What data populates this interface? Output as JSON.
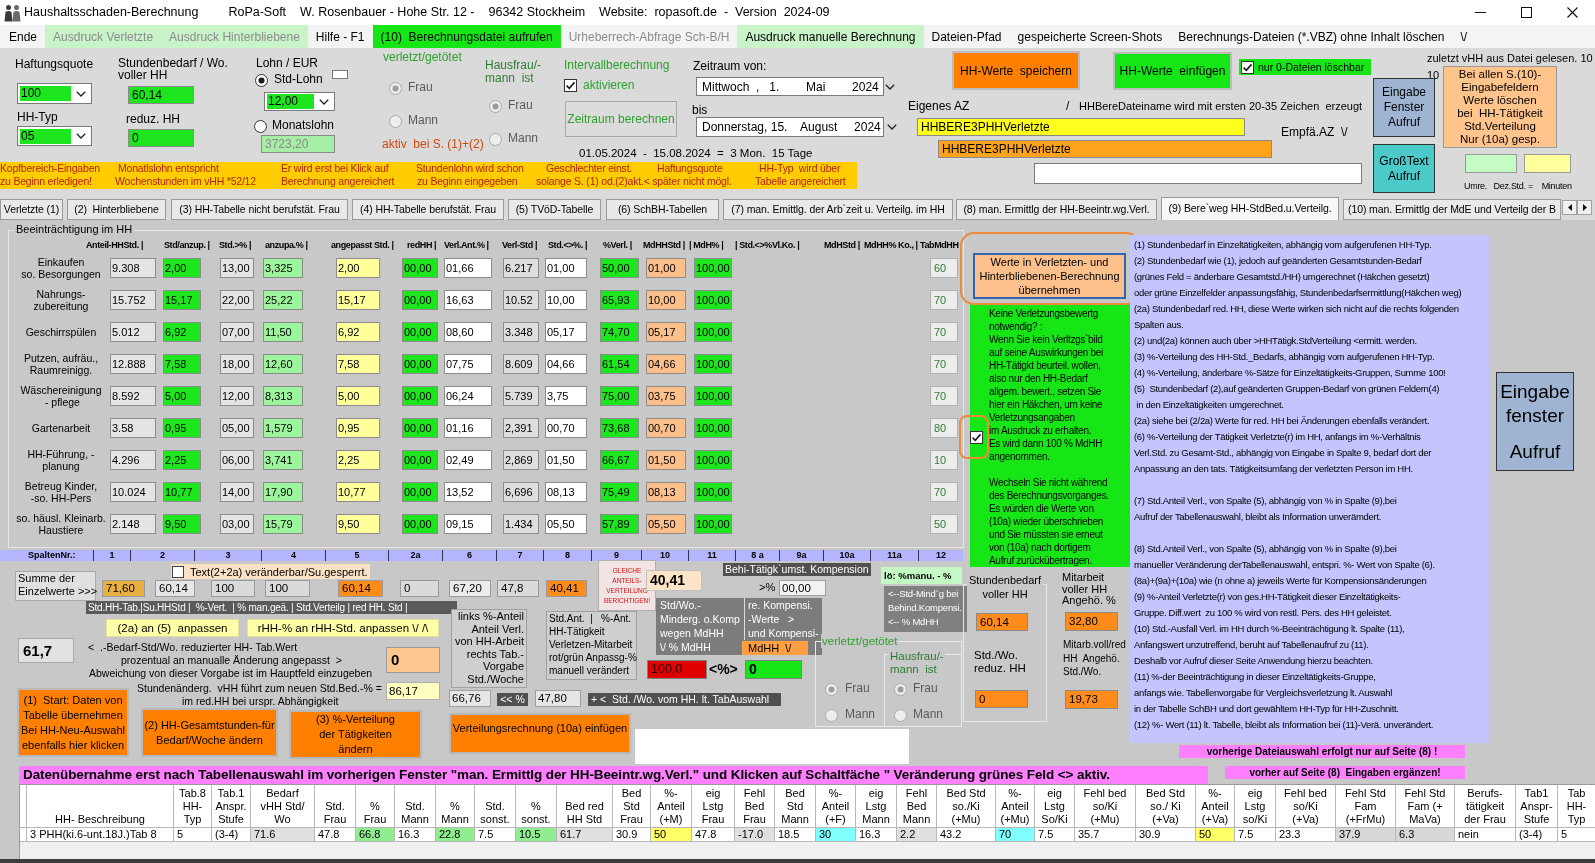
{
  "window": {
    "title": "Haushaltsschaden-Berechnung",
    "info": [
      "RoPa-Soft",
      "W. Rosenbauer - Hohe Str. 12 -",
      "96342 Stockheim",
      "Website:  ropasoft.de  -  Version  2024-09"
    ]
  },
  "menu": [
    {
      "label": "Ende",
      "kind": "plain",
      "disabled": false
    },
    {
      "label": "Ausdruck Verletzte",
      "kind": "pale",
      "disabled": true
    },
    {
      "label": "Ausdruck Hinterbliebene",
      "kind": "pale",
      "disabled": true
    },
    {
      "label": "Hilfe - F1",
      "kind": "plain",
      "disabled": false
    },
    {
      "label": "(10)  Berechnungsdatei aufrufen",
      "kind": "strong",
      "disabled": false
    },
    {
      "label": "Urheberrech-Abfrage Sch-B/H",
      "kind": "plain",
      "disabled": true
    },
    {
      "label": "Ausdruck manuelle Berechnung",
      "kind": "pale",
      "disabled": false
    },
    {
      "label": "Dateien-Pfad",
      "kind": "plain",
      "disabled": false
    },
    {
      "label": "gespeicherte Screen-Shots",
      "kind": "plain",
      "disabled": false
    },
    {
      "label": "Berechnungs-Dateien (*.VBZ) ohne Inhalt löschen",
      "kind": "plain",
      "disabled": false
    },
    {
      "label": "\\/",
      "kind": "plain",
      "disabled": false
    }
  ],
  "header_form": {
    "liability": {
      "label": "Haftungsquote",
      "value": "100"
    },
    "household_type": {
      "label": "HH-Typ",
      "value": "05"
    },
    "hours_full": {
      "label_lines": [
        "Stundenbedarf / Wo.",
        "voller HH"
      ],
      "value": "60,14"
    },
    "hours_reduced": {
      "label": "reduz. HH",
      "value": "0"
    },
    "wage": {
      "label": "Lohn / EUR",
      "options": [
        {
          "label": "Std-Lohn",
          "selected": true
        },
        {
          "label": "Monatslohn",
          "selected": false
        }
      ],
      "hourly": "12,00",
      "monthly": "3723,20"
    },
    "injured": {
      "label": "verletzt/getötet",
      "disabled": true,
      "options": [
        {
          "label": "Frau",
          "selected": true
        },
        {
          "label": "Mann",
          "selected": false
        }
      ],
      "note": "aktiv  bei S. (1)+(2)"
    },
    "homemaker": {
      "label_lines": [
        "Hausfrau/-",
        "mann  ist"
      ],
      "disabled": true,
      "options": [
        {
          "label": "Frau",
          "selected": true
        },
        {
          "label": "Mann",
          "selected": false
        }
      ]
    },
    "interval": {
      "label": "Intervallberechnung",
      "checkbox_label": "aktivieren",
      "checked": true,
      "button": "Zeitraum berechnen"
    },
    "period": {
      "from_label": "Zeitraum von:",
      "from": "Mittwoch  ,   1.        Mai        2024",
      "to_label": "bis",
      "to": "Donnerstag, 15.    August     2024",
      "summary": "01.05.2024  -  15.08.2024  =  3 Mon.  15 Tage"
    }
  },
  "file_panel": {
    "save_button": "HH-Werte  speichern",
    "insert_button": "HH-Werte  einfügen",
    "zero_files": {
      "label": "nur 0-Dateien löschbar",
      "checked": true
    },
    "last_read": "zuletzt vHH aus Datei gelesen. 10",
    "last_read_value": "10",
    "clear_button_lines": [
      "Bei allen S.(10)-",
      "Eingabefeldern",
      "Werte löschen",
      "bei  HH-Tätigkeit",
      "Std.Verteilung",
      "Nur (10a) gesp."
    ],
    "input_window_button_lines": [
      "Eingabe",
      "Fenster",
      "Aufruf"
    ],
    "large_text_button_lines": [
      "GroßText",
      "Aufruf"
    ],
    "converter_label": "Umre.   Dez.Std. =    Minuten",
    "own_ref_label": "Eigenes AZ",
    "separator": "/",
    "file_name_hint": "HHBereDateiname wird mit ersten 20-35 Zeichen  erzeugt",
    "own_ref": "HHBERE3PHHVerletzte",
    "recipient_label": "Empfä.AZ  \\/",
    "recipient_ref": "HHBERE3PHHVerletzte"
  },
  "hint_banner": {
    "notes": [
      {
        "lines": [
          "Kopfbereich-Eingaben",
          "zu Beginn erledigen!"
        ]
      },
      {
        "lines": [
          "Monatlslohn entspricht",
          "Wochenstunden im vHH *52/12"
        ]
      },
      {
        "lines": [
          "Er wird erst bei Klick auf",
          "Berechnung angereichert"
        ]
      },
      {
        "lines": [
          "Stundenlohn wird schon",
          "zu Beginn eingegeben"
        ]
      },
      {
        "lines": [
          "Geschlechter einst.",
          "solange S. (1) od.(2)akt.< später nicht mögl."
        ]
      },
      {
        "lines": [
          "Haftungsquote"
        ]
      },
      {
        "lines": [
          "HH-Typ  wird über",
          "Tabelle angereichert"
        ]
      }
    ]
  },
  "tabs": [
    {
      "label": "Verletzte (1)",
      "selected": false
    },
    {
      "label": "(2)  Hinterbliebene",
      "selected": false
    },
    {
      "label": "(3) HH-Tabelle nicht berufstät. Frau",
      "selected": false
    },
    {
      "label": "(4) HH-Tabelle berufstät. Frau",
      "selected": false
    },
    {
      "label": "(5) TVöD-Tabelle",
      "selected": false
    },
    {
      "label": "(6) SchBH-Tabellen",
      "selected": false
    },
    {
      "label": "(7) man. Emittlg. der Arb`zeit u. Verteilg. im HH",
      "selected": false
    },
    {
      "label": "(8) man. Ermittlg der HH-Beeintr.wg.Verl.",
      "selected": false
    },
    {
      "label": "(9) Bere`weg HH-StdBed.u.Verteilg.",
      "selected": true
    },
    {
      "label": "(10) man. Ermittlg der MdE und Verteilg der B",
      "selected": false
    }
  ],
  "impairment": {
    "title": "Beeinträchtigung im HH",
    "header": [
      "Anteil-HHStd. |",
      "Std/anzup. |",
      "Std.>% |",
      "anzupa.% |",
      "angepasst Std. |",
      "redHH |",
      "Verl.Ant.% |",
      "Verl-Std |",
      "Std.<>%. |",
      "%Verl. |",
      "MdHHStd |",
      "| MdH% |",
      "| Std.<>%Vl.Ko. |",
      "MdHStd |",
      "MdHH% Ko., |",
      "TabMdHH"
    ],
    "rows": [
      {
        "label_lines": [
          "Einkaufen",
          "so. Besorgungen"
        ],
        "values": [
          "9.308",
          "2,00",
          "13,00",
          "3,325",
          "2,00",
          "00,00",
          "01,66",
          "6.217",
          "01,00",
          "50,00",
          "01,00",
          "100,00"
        ],
        "table_value": "60"
      },
      {
        "label_lines": [
          "Nahrungs-",
          "zubereitung"
        ],
        "values": [
          "15.752",
          "15,17",
          "22,00",
          "25,22",
          "15,17",
          "00,00",
          "16,63",
          "10.52",
          "10,00",
          "65,93",
          "10,00",
          "100,00"
        ],
        "table_value": "70"
      },
      {
        "label_lines": [
          "Geschirrspülen"
        ],
        "values": [
          "5.012",
          "6,92",
          "07,00",
          "11,50",
          "6,92",
          "00,00",
          "08,60",
          "3.348",
          "05,17",
          "74,70",
          "05,17",
          "100,00"
        ],
        "table_value": "70"
      },
      {
        "label_lines": [
          "Putzen, aufräu.,",
          "Raumreinigg."
        ],
        "values": [
          "12.888",
          "7,58",
          "18,00",
          "12,60",
          "7,58",
          "00,00",
          "07,75",
          "8.609",
          "04,66",
          "61,54",
          "04,66",
          "100,00"
        ],
        "table_value": "70"
      },
      {
        "label_lines": [
          "Wäschereinigung",
          " - pflege"
        ],
        "values": [
          "8.592",
          "5,00",
          "12,00",
          "8,313",
          "5,00",
          "00,00",
          "06,24",
          "5.739",
          "3,75",
          "75,00",
          "03,75",
          "100,00"
        ],
        "table_value": "70"
      },
      {
        "label_lines": [
          "Gartenarbeit"
        ],
        "values": [
          "3.58",
          "0,95",
          "05,00",
          "1,579",
          "0,95",
          "00,00",
          "01,16",
          "2,391",
          "00,70",
          "73,68",
          "00,70",
          "100,00"
        ],
        "table_value": "80"
      },
      {
        "label_lines": [
          "HH-Führung, -",
          "planung"
        ],
        "values": [
          "4.296",
          "2,25",
          "06,00",
          "3,741",
          "2,25",
          "00,00",
          "02,49",
          "2,869",
          "01,50",
          "66,67",
          "01,50",
          "100,00"
        ],
        "table_value": "10"
      },
      {
        "label_lines": [
          "Betreug Kinder,",
          "-so. HH-Pers"
        ],
        "values": [
          "10.024",
          "10,77",
          "14,00",
          "17,90",
          "10,77",
          "00,00",
          "13,52",
          "6,696",
          "08,13",
          "75,49",
          "08,13",
          "100,00"
        ],
        "table_value": "70"
      },
      {
        "label_lines": [
          "so. häusl. Kleinarb.",
          "Haustiere"
        ],
        "values": [
          "2.148",
          "9,50",
          "03,00",
          "15,79",
          "9,50",
          "00,00",
          "09,15",
          "1.434",
          "05,50",
          "57,89",
          "05,50",
          "100,00"
        ],
        "table_value": "50"
      }
    ],
    "column_numbers_label": "SpaltenNr.:",
    "column_numbers": [
      "1",
      "2",
      "3",
      "4",
      "5",
      "2a",
      "6",
      "7",
      "8",
      "9",
      "10",
      "11",
      "8 a",
      "9a",
      "10a",
      "11a",
      "12"
    ]
  },
  "transfer_button": {
    "lines": [
      "Werte in Verletzten- und",
      "Hinterbliebenen-Berechnung",
      "übernehmen"
    ]
  },
  "no_injury": {
    "checked": true,
    "lines": [
      "Keine Verletzungsbewertg",
      "notwendig? :",
      "Wenn Sie kein Verltzgs`bild",
      "auf seine Auswirkungen bei",
      "HH-Tätigkt beurteil. wollen,",
      "also nur den HH-Bedarf",
      "allgem. bewert., setzen Sie",
      "hier ein Häkchen, um keine",
      "Verletzungsangaben",
      "im Ausdruck zu erhalten.",
      "Es wird dann 100 % MdHH",
      "angenommen."
    ],
    "warning_lines": [
      "Wechseln Sie nicht während",
      "des Berechnungsvorganges.",
      "Es würden die Werte von",
      "(10a) wieder überschrieben",
      "und Sie müssten sie erneut",
      "von (10a) nach dortigem",
      "Aufruf zurückübertragen."
    ]
  },
  "notes": [
    {
      "lines": [
        "(1) Stundenbedarf in Einzeltätigkeiten, abhängig vom aufgerufenen HH-Typ.",
        "(2) Stundenbedarf wie (1), jedoch auf geänderten Gesamtstunden-Bedarf",
        "(grünes Feld = änderbare Gesamtstd./HH) umgerechnet (Häkchen gesetzt)",
        "oder grüne Einzelfelder anpassungsfähig, Stundenbedarfsermittlung(Häkchen weg)",
        "(2a) Stundenbedarf red. HH, diese Werte wirken sich nicht auf die rechts folgenden",
        "Spalten aus.",
        "(2) und(2a) können auch über >HHTätigk.StdVerteilung <ermitt. werden.",
        "(3) %-Verteilung des HH-Std._Bedarfs, abhängig vom aufgerufenen HH-Typ.",
        "(4) %-Verteilung, änderbare %-Sätze für Einzeltätigkeits-Gruppen, Summe 100!",
        "(5)  Stundenbedarf (2),auf geänderten Gruppen-Bedarf von grünen Feldern(4)",
        " in den Einzeltätigkeiten umgerechnet.",
        "(2a) siehe bei (2/2a) Werte für red. HH bei Änderungen ebenfalls verändert.",
        "(6) %-Verteilung der Tätigkeit Verletzte(r) im HH, anfangs im %-Verhältnis",
        "Verl.Std. zu Gesamt-Std., abhängig von Eingabe in Spalte 9, bedarf dort der",
        "Anpassung an den tats. Tätigkeitsumfang der verletzten Person im HH."
      ]
    },
    {
      "lines": [
        "(7) Std.Anteil Verl., von Spalte (5), abhängig von % in Spalte (9),bei",
        "Aufruf der Tabellenauswahl, bleibt als Information unverämdert."
      ]
    },
    {
      "lines": [
        "(8) Std.Anteil Verl., von Spalte (5), abhängig von % in Spalte (9),bei",
        "manueller Veränderung derTabellenauswahl, entspri. %- Wert von Spalte (6).",
        "(8a)+(9a)+(10a) wie (n ohne a) jeweils Werte für Kompensionsänderungen",
        "(9) %-Anteil Verletzte(r) von ges.HH-Tätigkeit dieser Einzeltätigkeits-",
        "Gruppe. Diff.wert  zu 100 % wird von restl. Pers. des HH geleistet.",
        "(10) Std.-Ausfall Verl. im HH durch %-Beeinträchtigung lt. Spalte (11),",
        "Anfangswert unzutreffend, beruht auf Tabellenaufruf zu (11).",
        "Deshalb vor Aufruf dieser Seite Anwendung hierzu beachten.",
        "(11) %-der Beeinträchtigung in dieser Einzeltätigkeits-Gruppe,",
        "anfangs wie. Tabellenvorgabe für Vergleichsverletzung lt. Auswahl",
        "in der Tabelle SchBH und dort gewähltem HH-Typ für HH-Zuschnitt.",
        "(12) %- Wert (11) lt. Tabelle, bleibt als Information bei (11)-Verä. unverändert."
      ]
    }
  ],
  "input_window_button": {
    "title_lines": [
      "Eingabe",
      "fenster"
    ],
    "action": "Aufruf"
  },
  "sums": {
    "editable_checkbox": {
      "label": "Text(2+2a) veränderbar/Su.gesperrt.",
      "checked": false
    },
    "label_lines": [
      "Summe der",
      "Einzelwerte >>>"
    ],
    "values": [
      "71,60",
      "60,14",
      "100",
      "100",
      "60,14",
      "0",
      "67,20",
      "47,8",
      "40,41"
    ],
    "legend": "Std.HH-Tab.|Su.HHStd |  %-Vert.  | % man.geä. | Std.Verteilg | red HH. Std |",
    "adjust_buttons": [
      "(2a) an (5)  anpassen",
      "rHH-% an rHH-Std. anpassen \\/ /\\"
    ]
  },
  "reduced": {
    "value": "61,7",
    "lines": [
      "<  .-Bedarf-Std/Wo. reduzierter HH- Tab.Wert",
      "prozentual an manualle Änderung angepasst  >",
      "Abweichung von dieser Vorgabe ist im Hauptfeld einzugeben"
    ],
    "deviation": "0",
    "change_lines": [
      "Stundenänderg.  vHH führt zum neuen Std.Bed.-% =",
      "im red.HH bei urspr. Abhängigkeit"
    ],
    "change_value": "86,17"
  },
  "action_buttons": [
    {
      "lines": [
        "(1)  Start: Daten von",
        "Tabelle übernehmen",
        "Bei HH-Neu-Auswahl",
        "ebenfalls hier klicken"
      ]
    },
    {
      "lines": [
        "(2) HH-Gesamtstunden-für",
        "Bedarf/Woche ändern"
      ]
    },
    {
      "lines": [
        "(3) %-Verteilung",
        "der Tätigkeiten",
        "ändern"
      ]
    },
    {
      "lines": [
        "Verteilungsrechnung (10a) einfügen"
      ]
    }
  ],
  "share": {
    "left_lines": [
      "links %-Anteil",
      "Anteil Verl.",
      "von HH-Arbeit",
      "rechts Tab.-",
      "Vorgabe",
      "Std./Woche"
    ],
    "right_lines": [
      "Std.Ant.  |   %-Ant.",
      "HH-Tätigkeit",
      "Verletzen-Mitarbeit",
      "rot/grün Anpassg-%",
      "manuell verändert"
    ],
    "left_value": "66,76",
    "arrow": "<< %",
    "right_value": "47,80",
    "caption": "+ <  Std. /Wo. vom HH. lt. TabAuswahl"
  },
  "correction_button": {
    "lines": [
      "GLEICHE",
      "ANTEILS-",
      "VERTEILUNG",
      "BERICHTIGEN!"
    ]
  },
  "equal_value": "40,41",
  "compensation": {
    "title": "Behi-Tätigk`umst. Kompension",
    "percent_label": ">%",
    "percent": "00,00",
    "left_lines": [
      "Std/Wo.-",
      "Minderg. o.Komp",
      "wegen MdHH",
      "\\/ % MdHH"
    ],
    "right_lines": [
      "re. Kompensi.",
      "-Werte   >",
      "und Kompensi-"
    ],
    "selector": "MdHH  \\/",
    "reduction": "100,0",
    "compare": "<%>",
    "difference": "0",
    "manual_label": "lö: %manu. - %",
    "hint_lines": [
      "<--Std-Mind`g bei",
      "Behind.Kompensi.",
      "<-- % MdHH"
    ]
  },
  "lower_injured": {
    "label": "verletzt/getötet",
    "disabled": true,
    "options": [
      {
        "label": "Frau",
        "selected": true
      },
      {
        "label": "Mann",
        "selected": false
      }
    ]
  },
  "lower_homemaker": {
    "label_lines": [
      "Hausfrau/-",
      "mann  ist"
    ],
    "disabled": true,
    "options": [
      {
        "label": "Frau",
        "selected": true
      },
      {
        "label": "Mann",
        "selected": false
      }
    ]
  },
  "hours_group": {
    "label_lines": [
      "Stundenbedarf",
      "voller HH"
    ],
    "full": "60,14",
    "reduced_lines": [
      "Std./Wo.",
      "reduz. HH"
    ],
    "reduced": "0"
  },
  "family_group": {
    "label_lines": [
      "Mitarbeit",
      "voller HH",
      "Angehö. %"
    ],
    "percent": "32,80",
    "hours_lines": [
      "Mitarb.voll/red",
      "HH  Angehö.",
      "Std./Wo."
    ],
    "hours": "19,73"
  },
  "page_hints": [
    "vorherige Dateiauswahl erfolgt nur auf Seite (8) !",
    "vorher auf Seite (8)  Eingaben ergänzen!"
  ],
  "data_banner": "Datenübernahme erst nach Tabellenauswahl im vorherigen Fenster \"man. Ermittlg der HH-Beeintr.wg.Verl.\" und Klicken auf Schaltfäche \" Veränderung grünes Feld <> aktiv.",
  "data_grid": {
    "columns": [
      {
        "lines": [
          "HH- Beschreibung"
        ]
      },
      {
        "lines": [
          "Tab.8",
          "HH-",
          "Typ"
        ]
      },
      {
        "lines": [
          "Tab.1",
          "Anspr.",
          "Stufe"
        ]
      },
      {
        "lines": [
          "Bedarf",
          "vHH Std/",
          "Wo"
        ]
      },
      {
        "lines": [
          "Std.",
          "Frau"
        ]
      },
      {
        "lines": [
          "%",
          "Frau"
        ]
      },
      {
        "lines": [
          "Std.",
          "Mann"
        ]
      },
      {
        "lines": [
          "%",
          "Mann"
        ]
      },
      {
        "lines": [
          "Std.",
          "sonst."
        ]
      },
      {
        "lines": [
          "%",
          "sonst."
        ]
      },
      {
        "lines": [
          "Bed red",
          "HH Std"
        ]
      },
      {
        "lines": [
          "Bed",
          "Std",
          "Frau"
        ]
      },
      {
        "lines": [
          "%-",
          "Anteil",
          "(+M)"
        ]
      },
      {
        "lines": [
          "eig",
          "Lstg",
          "Frau"
        ]
      },
      {
        "lines": [
          "Fehl",
          "Bed",
          "Frau"
        ]
      },
      {
        "lines": [
          "Bed",
          "Std",
          "Mann"
        ]
      },
      {
        "lines": [
          "%-",
          "Anteil",
          "(+F)"
        ]
      },
      {
        "lines": [
          "eig",
          "Lstg",
          "Mann"
        ]
      },
      {
        "lines": [
          "Fehl",
          "Bed",
          "Mann"
        ]
      },
      {
        "lines": [
          "Bed Std",
          "so./Ki",
          "(+Mu)"
        ]
      },
      {
        "lines": [
          "%-",
          "Anteil",
          "(+Mu)"
        ]
      },
      {
        "lines": [
          "eig",
          "Lstg",
          "So/Ki"
        ]
      },
      {
        "lines": [
          "Fehl bed",
          "so/Ki",
          "(+Mu)"
        ]
      },
      {
        "lines": [
          "Bed Std",
          "so./ Ki",
          "(+Va)"
        ]
      },
      {
        "lines": [
          "%-",
          "Anteil",
          "(+Va)"
        ]
      },
      {
        "lines": [
          "eig",
          "Lstg",
          "so/Ki"
        ]
      },
      {
        "lines": [
          "Fehl bed",
          "so/Ki",
          "(+Va)"
        ]
      },
      {
        "lines": [
          "Fehl Std",
          "Fam",
          "(+FrMu)"
        ]
      },
      {
        "lines": [
          "Fehl Std",
          "Fam (+",
          "MaVa)"
        ]
      },
      {
        "lines": [
          "Berufs-",
          "tätigkeit",
          "der Frau"
        ]
      },
      {
        "lines": [
          "Tab1",
          "Anspr-",
          "Stufe"
        ]
      },
      {
        "lines": [
          "Tab",
          "HH-",
          "Typ"
        ]
      }
    ],
    "rows": [
      {
        "cells": [
          "3 PHH(ki.6-unt.18J.)Tab 8",
          "5",
          "(3-4)",
          "71.6",
          "47.8",
          "66.8",
          "16.3",
          "22.8",
          "7.5",
          "10.5",
          "61.7",
          "30.9",
          "50",
          "47.8",
          "-17.0",
          "18.5",
          "30",
          "16.3",
          "2.2",
          "43.2",
          "70",
          "7.5",
          "35.7",
          "30.9",
          "50",
          "7.5",
          "23.3",
          "37.9",
          "6.3",
          "nein",
          "(3-4)",
          "5"
        ]
      }
    ]
  }
}
